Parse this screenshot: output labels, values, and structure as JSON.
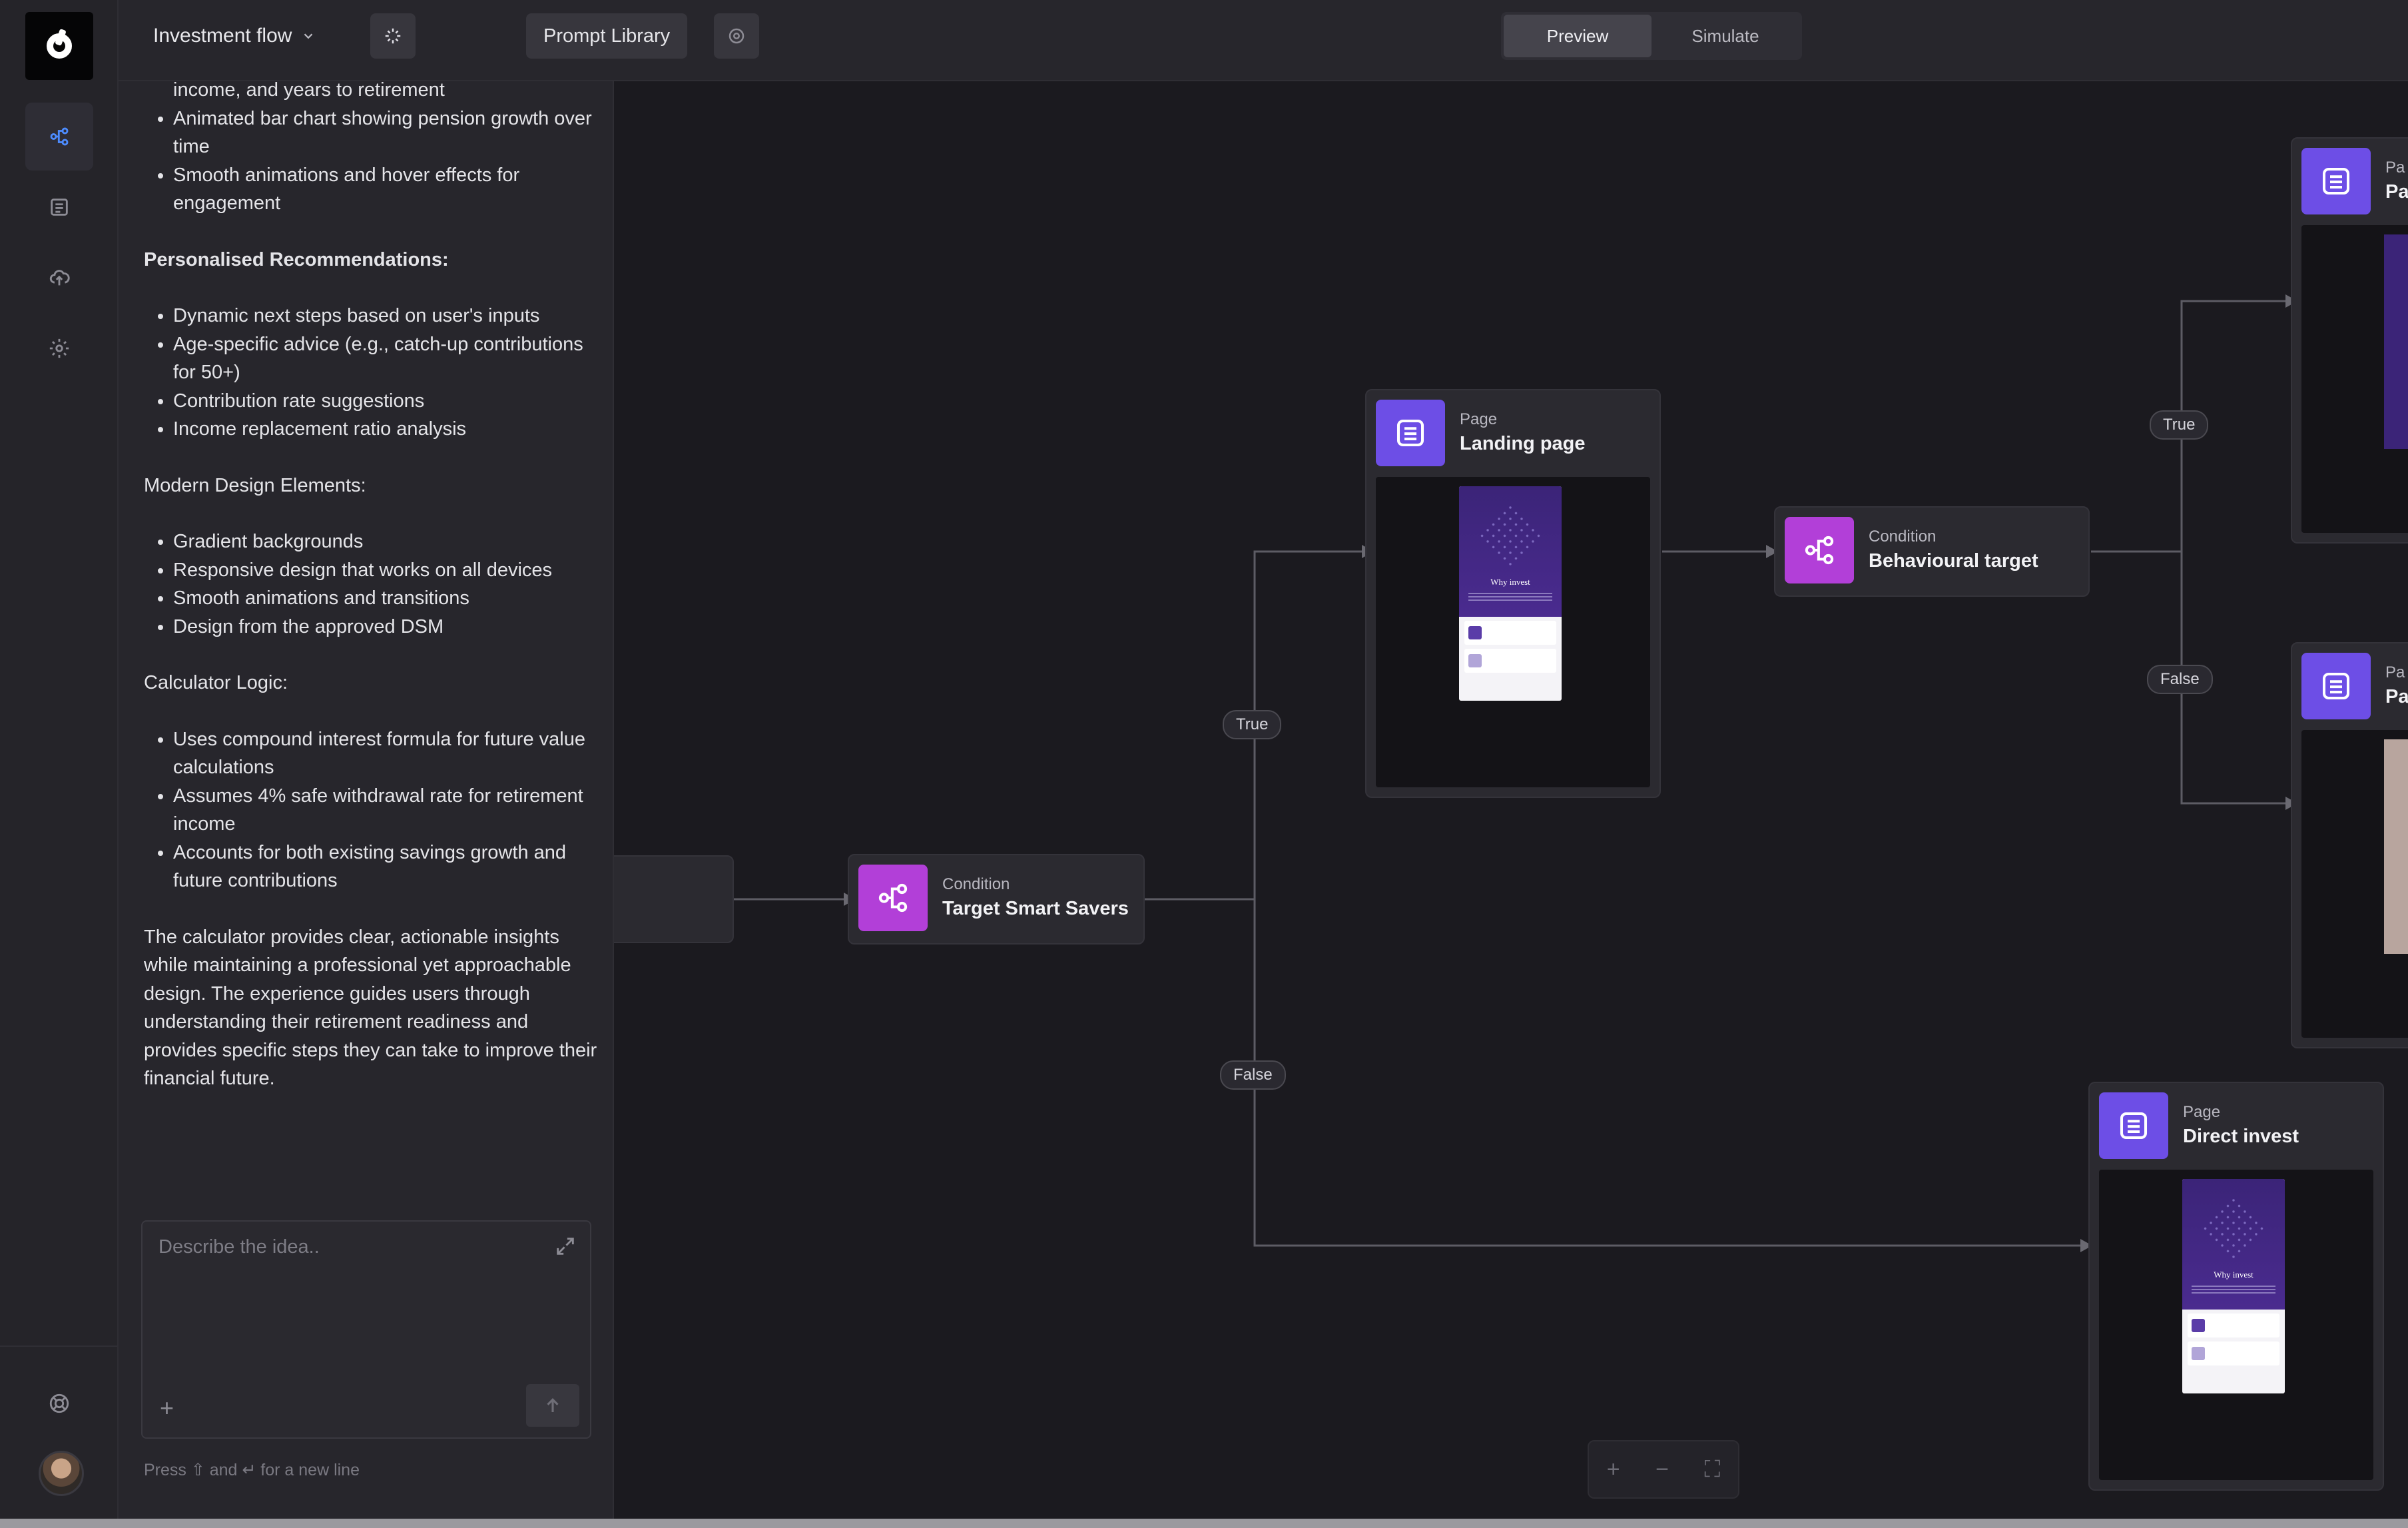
{
  "app": {
    "flow_name": "Investment flow",
    "prompt_library": "Prompt Library",
    "modes": [
      "Preview",
      "Simulate"
    ],
    "active_mode": "Preview"
  },
  "chat": {
    "intro_list": [
      "income, and years to retirement",
      "Animated bar chart showing pension growth over time",
      "Smooth animations and hover effects for engagement"
    ],
    "recommendations_heading": "Personalised Recommendations:",
    "recommendations": [
      "Dynamic next steps based on user's inputs",
      "Age-specific advice (e.g., catch-up contributions for 50+)",
      "Contribution rate suggestions",
      "Income replacement ratio analysis"
    ],
    "design_heading": "Modern Design Elements:",
    "design": [
      "Gradient backgrounds",
      "Responsive design that works on all devices",
      "Smooth animations and transitions",
      "Design from the approved DSM"
    ],
    "logic_heading": "Calculator Logic:",
    "logic": [
      "Uses compound interest formula for future value calculations",
      "Assumes 4% safe withdrawal rate for retirement income",
      "Accounts for both existing savings growth and future contributions"
    ],
    "summary": "The calculator provides clear, actionable insights while maintaining a professional yet approachable design. The experience guides users through understanding their retirement readiness and provides specific steps they can take to improve their financial future.",
    "composer_placeholder": "Describe the idea..",
    "hint": "Press ⇧ and ↵ for a new line"
  },
  "canvas": {
    "nodes": {
      "target_smart_savers": {
        "kind": "Condition",
        "name": "Target Smart Savers"
      },
      "landing_page": {
        "kind": "Page",
        "name": "Landing page"
      },
      "behavioural_target": {
        "kind": "Condition",
        "name": "Behavioural target"
      },
      "direct_invest": {
        "kind": "Page",
        "name": "Direct invest"
      },
      "page_top_right": {
        "kind": "Pa",
        "name": "Pa"
      },
      "page_mid_right": {
        "kind": "Pa",
        "name": "Pa"
      }
    },
    "preview_phone": {
      "title": "Why invest"
    },
    "edge_labels": {
      "true_1": "True",
      "false_1": "False",
      "true_2": "True",
      "false_2": "False"
    },
    "zoom_controls": [
      "+",
      "−",
      "⛶"
    ]
  },
  "colors": {
    "page_icon": "#6d4ee6",
    "condition_icon": "#b23fd8",
    "accent_blue": "#4d8cff"
  }
}
